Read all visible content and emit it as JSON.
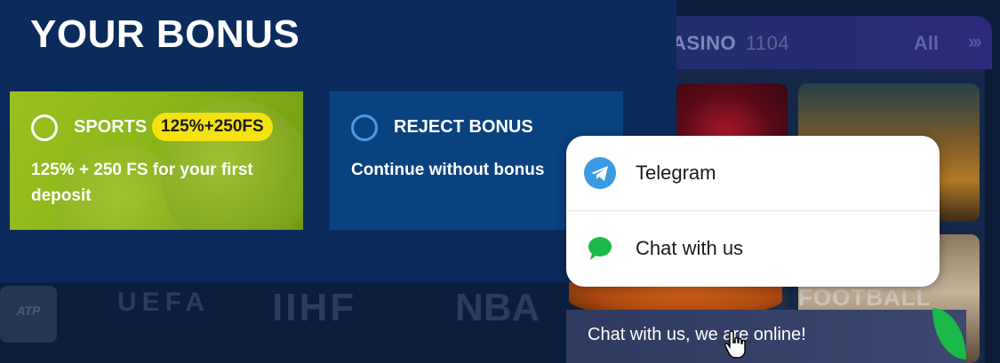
{
  "bonus": {
    "title": "YOUR BONUS",
    "options": [
      {
        "label": "SPORTS",
        "badge": "125%+250FS",
        "description": "125% + 250 FS for your first deposit"
      },
      {
        "label": "REJECT BONUS",
        "description": "Continue without bonus"
      }
    ]
  },
  "casino": {
    "title": "ASINO",
    "count": "1104",
    "all_label": "All",
    "tile_label": "FOOTBALL"
  },
  "logos": [
    "ATP",
    "UEFA",
    "IIHF",
    "NBA"
  ],
  "chat_popup": {
    "options": [
      {
        "label": "Telegram",
        "icon": "telegram-icon"
      },
      {
        "label": "Chat with us",
        "icon": "chat-bubble-icon"
      }
    ]
  },
  "chat_strip": {
    "text": "Chat with us, we are online!"
  },
  "colors": {
    "panel_bg": "#0a2b5c",
    "sports_card": "#8cb81a",
    "reject_card": "#09427f",
    "badge": "#f5e20e",
    "telegram": "#3a9be2",
    "chat_green": "#1db84a"
  }
}
